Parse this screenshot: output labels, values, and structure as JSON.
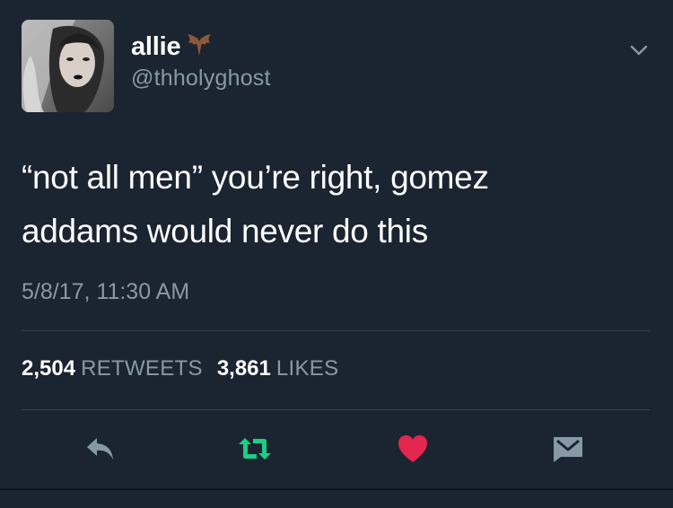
{
  "user": {
    "display_name": "allie",
    "handle": "@thholyghost",
    "name_emoji": "bat-icon",
    "avatar": "profile-photo"
  },
  "tweet": {
    "text_line1": "“not all men” you’re right, gomez",
    "text_line2": "addams would never do this",
    "timestamp": "5/8/17, 11:30 AM"
  },
  "stats": {
    "retweets_count": "2,504",
    "retweets_label": "RETWEETS",
    "likes_count": "3,861",
    "likes_label": "LIKES"
  },
  "actions": [
    {
      "icon": "reply-icon"
    },
    {
      "icon": "retweet-icon",
      "color": "#19cf86"
    },
    {
      "icon": "heart-icon",
      "color": "#e2264d"
    },
    {
      "icon": "direct-message-icon"
    }
  ],
  "colors": {
    "background": "#1b2431",
    "secondary_text": "#8899a6",
    "divider": "#38444d",
    "retweet_green": "#19cf86",
    "like_red": "#e2264d"
  }
}
